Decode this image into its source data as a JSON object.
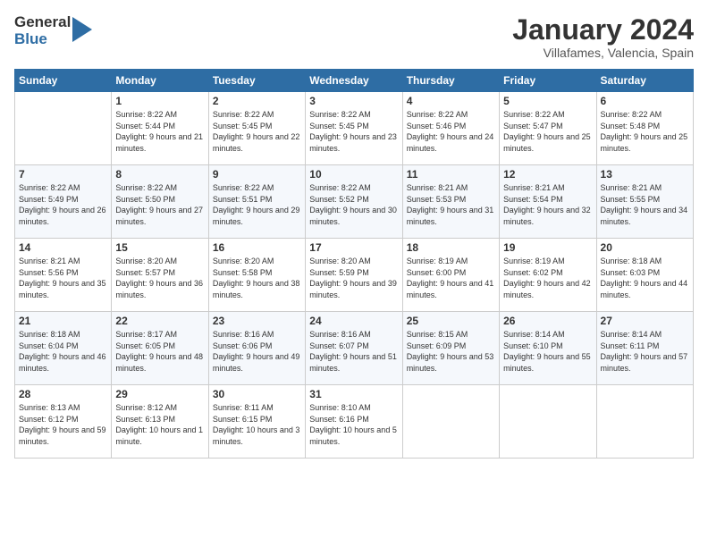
{
  "header": {
    "logo_general": "General",
    "logo_blue": "Blue",
    "month_title": "January 2024",
    "location": "Villafames, Valencia, Spain"
  },
  "days_of_week": [
    "Sunday",
    "Monday",
    "Tuesday",
    "Wednesday",
    "Thursday",
    "Friday",
    "Saturday"
  ],
  "weeks": [
    [
      {
        "day": "",
        "sunrise": "",
        "sunset": "",
        "daylight": ""
      },
      {
        "day": "1",
        "sunrise": "Sunrise: 8:22 AM",
        "sunset": "Sunset: 5:44 PM",
        "daylight": "Daylight: 9 hours and 21 minutes."
      },
      {
        "day": "2",
        "sunrise": "Sunrise: 8:22 AM",
        "sunset": "Sunset: 5:45 PM",
        "daylight": "Daylight: 9 hours and 22 minutes."
      },
      {
        "day": "3",
        "sunrise": "Sunrise: 8:22 AM",
        "sunset": "Sunset: 5:45 PM",
        "daylight": "Daylight: 9 hours and 23 minutes."
      },
      {
        "day": "4",
        "sunrise": "Sunrise: 8:22 AM",
        "sunset": "Sunset: 5:46 PM",
        "daylight": "Daylight: 9 hours and 24 minutes."
      },
      {
        "day": "5",
        "sunrise": "Sunrise: 8:22 AM",
        "sunset": "Sunset: 5:47 PM",
        "daylight": "Daylight: 9 hours and 25 minutes."
      },
      {
        "day": "6",
        "sunrise": "Sunrise: 8:22 AM",
        "sunset": "Sunset: 5:48 PM",
        "daylight": "Daylight: 9 hours and 25 minutes."
      }
    ],
    [
      {
        "day": "7",
        "sunrise": "",
        "sunset": "",
        "daylight": ""
      },
      {
        "day": "8",
        "sunrise": "Sunrise: 8:22 AM",
        "sunset": "Sunset: 5:50 PM",
        "daylight": "Daylight: 9 hours and 27 minutes."
      },
      {
        "day": "9",
        "sunrise": "Sunrise: 8:22 AM",
        "sunset": "Sunset: 5:51 PM",
        "daylight": "Daylight: 9 hours and 29 minutes."
      },
      {
        "day": "10",
        "sunrise": "Sunrise: 8:22 AM",
        "sunset": "Sunset: 5:52 PM",
        "daylight": "Daylight: 9 hours and 30 minutes."
      },
      {
        "day": "11",
        "sunrise": "Sunrise: 8:21 AM",
        "sunset": "Sunset: 5:53 PM",
        "daylight": "Daylight: 9 hours and 31 minutes."
      },
      {
        "day": "12",
        "sunrise": "Sunrise: 8:21 AM",
        "sunset": "Sunset: 5:54 PM",
        "daylight": "Daylight: 9 hours and 32 minutes."
      },
      {
        "day": "13",
        "sunrise": "Sunrise: 8:21 AM",
        "sunset": "Sunset: 5:55 PM",
        "daylight": "Daylight: 9 hours and 34 minutes."
      }
    ],
    [
      {
        "day": "14",
        "sunrise": "",
        "sunset": "",
        "daylight": ""
      },
      {
        "day": "15",
        "sunrise": "Sunrise: 8:20 AM",
        "sunset": "Sunset: 5:57 PM",
        "daylight": "Daylight: 9 hours and 36 minutes."
      },
      {
        "day": "16",
        "sunrise": "Sunrise: 8:20 AM",
        "sunset": "Sunset: 5:58 PM",
        "daylight": "Daylight: 9 hours and 38 minutes."
      },
      {
        "day": "17",
        "sunrise": "Sunrise: 8:20 AM",
        "sunset": "Sunset: 5:59 PM",
        "daylight": "Daylight: 9 hours and 39 minutes."
      },
      {
        "day": "18",
        "sunrise": "Sunrise: 8:19 AM",
        "sunset": "Sunset: 6:00 PM",
        "daylight": "Daylight: 9 hours and 41 minutes."
      },
      {
        "day": "19",
        "sunrise": "Sunrise: 8:19 AM",
        "sunset": "Sunset: 6:02 PM",
        "daylight": "Daylight: 9 hours and 42 minutes."
      },
      {
        "day": "20",
        "sunrise": "Sunrise: 8:18 AM",
        "sunset": "Sunset: 6:03 PM",
        "daylight": "Daylight: 9 hours and 44 minutes."
      }
    ],
    [
      {
        "day": "21",
        "sunrise": "",
        "sunset": "",
        "daylight": ""
      },
      {
        "day": "22",
        "sunrise": "Sunrise: 8:17 AM",
        "sunset": "Sunset: 6:05 PM",
        "daylight": "Daylight: 9 hours and 48 minutes."
      },
      {
        "day": "23",
        "sunrise": "Sunrise: 8:16 AM",
        "sunset": "Sunset: 6:06 PM",
        "daylight": "Daylight: 9 hours and 49 minutes."
      },
      {
        "day": "24",
        "sunrise": "Sunrise: 8:16 AM",
        "sunset": "Sunset: 6:07 PM",
        "daylight": "Daylight: 9 hours and 51 minutes."
      },
      {
        "day": "25",
        "sunrise": "Sunrise: 8:15 AM",
        "sunset": "Sunset: 6:09 PM",
        "daylight": "Daylight: 9 hours and 53 minutes."
      },
      {
        "day": "26",
        "sunrise": "Sunrise: 8:14 AM",
        "sunset": "Sunset: 6:10 PM",
        "daylight": "Daylight: 9 hours and 55 minutes."
      },
      {
        "day": "27",
        "sunrise": "Sunrise: 8:14 AM",
        "sunset": "Sunset: 6:11 PM",
        "daylight": "Daylight: 9 hours and 57 minutes."
      }
    ],
    [
      {
        "day": "28",
        "sunrise": "",
        "sunset": "",
        "daylight": ""
      },
      {
        "day": "29",
        "sunrise": "Sunrise: 8:12 AM",
        "sunset": "Sunset: 6:13 PM",
        "daylight": "Daylight: 10 hours and 1 minute."
      },
      {
        "day": "30",
        "sunrise": "Sunrise: 8:11 AM",
        "sunset": "Sunset: 6:15 PM",
        "daylight": "Daylight: 10 hours and 3 minutes."
      },
      {
        "day": "31",
        "sunrise": "Sunrise: 8:10 AM",
        "sunset": "Sunset: 6:16 PM",
        "daylight": "Daylight: 10 hours and 5 minutes."
      },
      {
        "day": "",
        "sunrise": "",
        "sunset": "",
        "daylight": ""
      },
      {
        "day": "",
        "sunrise": "",
        "sunset": "",
        "daylight": ""
      },
      {
        "day": "",
        "sunrise": "",
        "sunset": "",
        "daylight": ""
      }
    ]
  ],
  "week7_sunday": {
    "day": "7",
    "sunrise": "Sunrise: 8:22 AM",
    "sunset": "Sunset: 5:49 PM",
    "daylight": "Daylight: 9 hours and 26 minutes."
  },
  "week14_sunday": {
    "day": "14",
    "sunrise": "Sunrise: 8:21 AM",
    "sunset": "Sunset: 5:56 PM",
    "daylight": "Daylight: 9 hours and 35 minutes."
  },
  "week21_sunday": {
    "day": "21",
    "sunrise": "Sunrise: 8:18 AM",
    "sunset": "Sunset: 6:04 PM",
    "daylight": "Daylight: 9 hours and 46 minutes."
  },
  "week28_sunday": {
    "day": "28",
    "sunrise": "Sunrise: 8:13 AM",
    "sunset": "Sunset: 6:12 PM",
    "daylight": "Daylight: 9 hours and 59 minutes."
  }
}
